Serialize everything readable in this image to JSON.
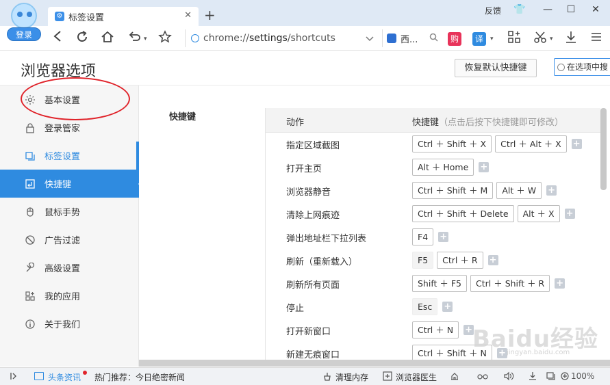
{
  "window": {
    "login_label": "登录",
    "feedback_label": "反馈",
    "tab": {
      "title": "标签设置",
      "close_glyph": "✕"
    },
    "new_tab_glyph": "+",
    "controls": {
      "skin_glyph": "👕",
      "minimize_glyph": "—",
      "maximize_glyph": "☐",
      "close_glyph": "✕"
    }
  },
  "toolbar": {
    "url_scheme": "chrome://",
    "url_host": "settings",
    "url_path": "/shortcuts",
    "search_engine_text": "西...",
    "ext_gou": "购",
    "ext_yi": "译"
  },
  "page": {
    "title": "浏览器选项",
    "restore_button": "恢复默认快捷键",
    "search_placeholder": "在选项中搜"
  },
  "sidebar": {
    "items": [
      {
        "label": "基本设置",
        "icon": "gear-icon"
      },
      {
        "label": "登录管家",
        "icon": "lock-icon"
      },
      {
        "label": "标签设置",
        "icon": "tabs-icon"
      },
      {
        "label": "快捷键",
        "icon": "keyboard-icon"
      },
      {
        "label": "鼠标手势",
        "icon": "mouse-icon"
      },
      {
        "label": "广告过滤",
        "icon": "block-icon"
      },
      {
        "label": "高级设置",
        "icon": "wrench-icon"
      },
      {
        "label": "我的应用",
        "icon": "apps-icon"
      },
      {
        "label": "关于我们",
        "icon": "info-icon"
      }
    ]
  },
  "shortcuts": {
    "section_label": "快捷键",
    "header_action": "动作",
    "header_keys": "快捷键",
    "header_hint": "（点击后按下快捷键即可修改）",
    "rows": [
      {
        "action": "指定区域截图",
        "keys": [
          "Ctrl ＋ Shift ＋ X",
          "Ctrl ＋ Alt ＋ X"
        ]
      },
      {
        "action": "打开主页",
        "keys": [
          "Alt ＋ Home"
        ]
      },
      {
        "action": "浏览器静音",
        "keys": [
          "Ctrl ＋ Shift ＋ M",
          "Alt ＋ W"
        ]
      },
      {
        "action": "清除上网痕迹",
        "keys": [
          "Ctrl ＋ Shift ＋ Delete",
          "Alt ＋ X"
        ]
      },
      {
        "action": "弹出地址栏下拉列表",
        "keys": [
          "F4"
        ]
      },
      {
        "action": "刷新（重新载入）",
        "keys": [
          "F5",
          "Ctrl ＋ R"
        ]
      },
      {
        "action": "刷新所有页面",
        "keys": [
          "Shift ＋ F5",
          "Ctrl ＋ Shift ＋ R"
        ]
      },
      {
        "action": "停止",
        "keys": [
          "Esc"
        ]
      },
      {
        "action": "打开新窗口",
        "keys": [
          "Ctrl ＋ N"
        ]
      },
      {
        "action": "新建无痕窗口",
        "keys": [
          "Ctrl ＋ Shift ＋ N"
        ]
      }
    ]
  },
  "statusbar": {
    "news": "头条资讯",
    "hot": "热门推荐：今日绝密新闻",
    "clean_memory": "清理内存",
    "browser_doctor": "浏览器医生",
    "zoom": "100%"
  },
  "watermark": {
    "main": "Baidu经验",
    "sub": "jingyan.baidu.com"
  }
}
